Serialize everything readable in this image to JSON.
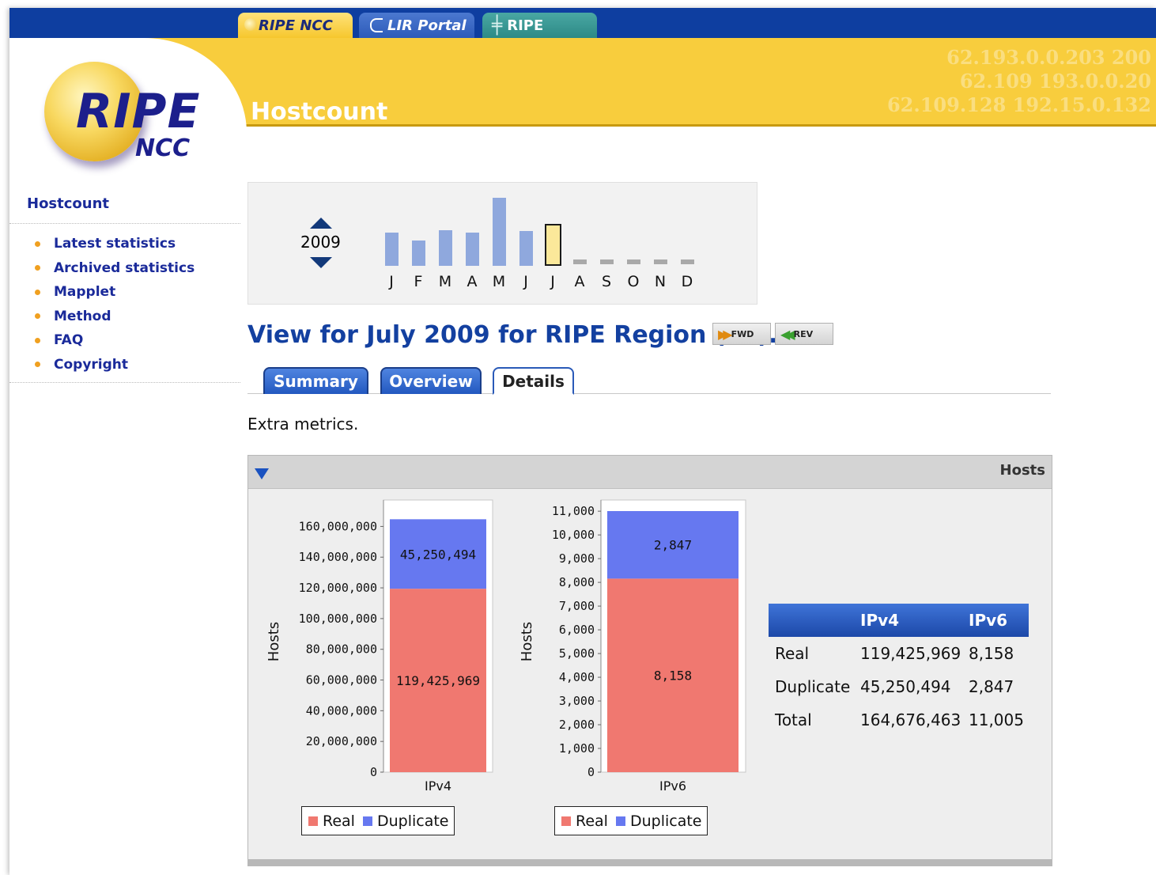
{
  "top_tabs": [
    {
      "label": "RIPE NCC"
    },
    {
      "label": "LIR Portal"
    },
    {
      "label": "RIPE"
    }
  ],
  "banner": {
    "title": "Hostcount",
    "watermark": [
      "62.193.0.0.203 200",
      "62.109 193.0.0.20",
      "62.109.128 192.15.0.132"
    ]
  },
  "logo": {
    "main": "RIPE",
    "sub": "NCC"
  },
  "sidebar": {
    "title": "Hostcount",
    "items": [
      {
        "label": "Latest statistics"
      },
      {
        "label": "Archived statistics"
      },
      {
        "label": "Mapplet"
      },
      {
        "label": "Method"
      },
      {
        "label": "FAQ"
      },
      {
        "label": "Copyright"
      }
    ]
  },
  "month_selector": {
    "year": "2009",
    "months": [
      "J",
      "F",
      "M",
      "A",
      "M",
      "J",
      "J",
      "A",
      "S",
      "O",
      "N",
      "D"
    ],
    "relative_levels": [
      0.49,
      0.37,
      0.52,
      0.49,
      1.0,
      0.51,
      0.62,
      0,
      0,
      0,
      0,
      0
    ],
    "selected_index": 6,
    "colors": {
      "bar": "#8fa8dd",
      "selected": "#fbe89a",
      "empty": "#a9a9a9"
    }
  },
  "view": {
    "title": "View for July 2009 for RIPE Region (all).",
    "fwd_label": "FWD",
    "rev_label": "REV"
  },
  "detail_tabs": [
    {
      "label": "Summary",
      "active": false
    },
    {
      "label": "Overview",
      "active": false
    },
    {
      "label": "Details",
      "active": true
    }
  ],
  "extra_text": "Extra metrics.",
  "panel": {
    "title": "Hosts"
  },
  "chart_data": [
    {
      "type": "bar",
      "stacked": true,
      "categories": [
        "IPv4"
      ],
      "ylabel": "Hosts",
      "ylim": [
        0,
        170000000
      ],
      "yticks": [
        0,
        20000000,
        40000000,
        60000000,
        80000000,
        100000000,
        120000000,
        140000000,
        160000000
      ],
      "ytick_labels": [
        "0",
        "20,000,000",
        "40,000,000",
        "60,000,000",
        "80,000,000",
        "100,000,000",
        "120,000,000",
        "140,000,000",
        "160,000,000"
      ],
      "series": [
        {
          "name": "Real",
          "values": [
            119425969
          ],
          "label": "119,425,969",
          "color": "#f07870"
        },
        {
          "name": "Duplicate",
          "values": [
            45250494
          ],
          "label": "45,250,494",
          "color": "#6678f0"
        }
      ],
      "legend": "bottom"
    },
    {
      "type": "bar",
      "stacked": true,
      "categories": [
        "IPv6"
      ],
      "ylabel": "Hosts",
      "ylim": [
        0,
        11005
      ],
      "yticks": [
        0,
        1000,
        2000,
        3000,
        4000,
        5000,
        6000,
        7000,
        8000,
        9000,
        10000,
        11000
      ],
      "ytick_labels": [
        "0",
        "1,000",
        "2,000",
        "3,000",
        "4,000",
        "5,000",
        "6,000",
        "7,000",
        "8,000",
        "9,000",
        "10,000",
        "11,000"
      ],
      "series": [
        {
          "name": "Real",
          "values": [
            8158
          ],
          "label": "8,158",
          "color": "#f07870"
        },
        {
          "name": "Duplicate",
          "values": [
            2847
          ],
          "label": "2,847",
          "color": "#6678f0"
        }
      ],
      "legend": "bottom"
    }
  ],
  "hosts_table": {
    "headers": [
      "",
      "IPv4",
      "IPv6"
    ],
    "rows": [
      [
        "Real",
        "119,425,969",
        "8,158"
      ],
      [
        "Duplicate",
        "45,250,494",
        "2,847"
      ],
      [
        "Total",
        "164,676,463",
        "11,005"
      ]
    ]
  },
  "legend_labels": {
    "real": "Real",
    "duplicate": "Duplicate"
  }
}
